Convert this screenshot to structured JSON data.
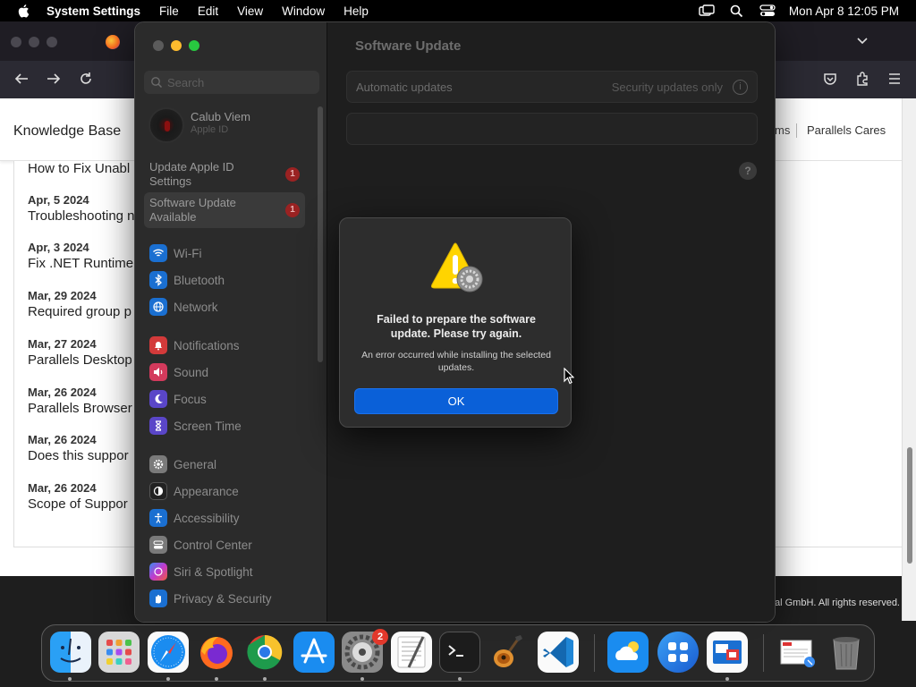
{
  "menubar": {
    "app": "System Settings",
    "items": [
      "File",
      "Edit",
      "View",
      "Window",
      "Help"
    ],
    "clock": "Mon Apr 8  12:05 PM"
  },
  "browser": {
    "site_title": "Knowledge Base",
    "nav_partial": "ms",
    "nav_cares": "Parallels Cares",
    "first_article": "How to Fix Unabl",
    "articles": [
      {
        "date": "Apr, 5 2024",
        "title": "Troubleshooting n"
      },
      {
        "date": "Apr, 3 2024",
        "title": "Fix .NET Runtime"
      },
      {
        "date": "Mar, 29 2024",
        "title": "Required group p"
      },
      {
        "date": "Mar, 27 2024",
        "title": "Parallels Desktop"
      },
      {
        "date": "Mar, 26 2024",
        "title": "Parallels Browser"
      },
      {
        "date": "Mar, 26 2024",
        "title": "Does this suppor"
      },
      {
        "date": "Mar, 26 2024",
        "title": "Scope of Suppor"
      }
    ],
    "copyright": "al GmbH. All rights reserved."
  },
  "settings": {
    "search_placeholder": "Search",
    "account": {
      "name": "Calub Viem",
      "sub": "Apple ID"
    },
    "notices": [
      {
        "label": "Update Apple ID Settings",
        "badge": "1"
      },
      {
        "label": "Software Update Available",
        "badge": "1"
      }
    ],
    "sidebar": [
      {
        "label": "Wi-Fi",
        "icon": "wifi-icon",
        "color": "#1a6fd1"
      },
      {
        "label": "Bluetooth",
        "icon": "bluetooth-icon",
        "color": "#1a6fd1"
      },
      {
        "label": "Network",
        "icon": "globe-icon",
        "color": "#1a6fd1"
      },
      {
        "label": "Notifications",
        "icon": "bell-icon",
        "color": "#d33a3a"
      },
      {
        "label": "Sound",
        "icon": "speaker-icon",
        "color": "#d33a5c"
      },
      {
        "label": "Focus",
        "icon": "moon-icon",
        "color": "#5a46c8"
      },
      {
        "label": "Screen Time",
        "icon": "hourglass-icon",
        "color": "#5a46c8"
      },
      {
        "label": "General",
        "icon": "gear-icon",
        "color": "#7a7a7a"
      },
      {
        "label": "Appearance",
        "icon": "appearance-icon",
        "color": "#222222"
      },
      {
        "label": "Accessibility",
        "icon": "accessibility-icon",
        "color": "#1a6fd1"
      },
      {
        "label": "Control Center",
        "icon": "control-center-icon",
        "color": "#7a7a7a"
      },
      {
        "label": "Siri & Spotlight",
        "icon": "siri-icon",
        "color": "#b43ab4"
      },
      {
        "label": "Privacy & Security",
        "icon": "hand-icon",
        "color": "#1a6fd1"
      }
    ],
    "content": {
      "title": "Software Update",
      "row_label": "Automatic updates",
      "row_value": "Security updates only",
      "info": "i",
      "help": "?"
    }
  },
  "alert": {
    "title": "Failed to prepare the software update. Please try again.",
    "message": "An error occurred while installing the selected updates.",
    "ok": "OK"
  },
  "dock": {
    "settings_badge": "2",
    "apps": [
      "finder",
      "launchpad",
      "safari",
      "firefox",
      "chrome",
      "app-store",
      "system-settings",
      "textedit",
      "terminal",
      "garageband",
      "vscode",
      "weather-cloud",
      "parallels-app",
      "parallels-folder",
      "preview-doc",
      "trash"
    ]
  },
  "colors": {
    "accent": "#0a60d8",
    "badge": "#9a2222",
    "warning": "#ffd400"
  }
}
